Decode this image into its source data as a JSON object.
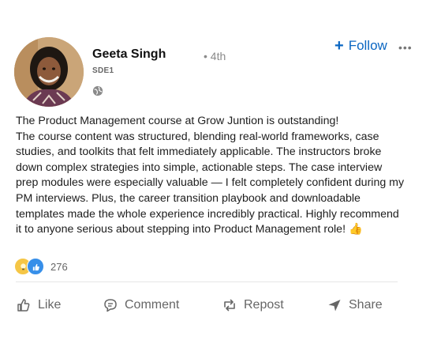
{
  "author": {
    "name": "Geeta Singh",
    "connection_degree": "• 4th",
    "headline": "SDE1",
    "visibility_icon": "globe-icon"
  },
  "header_actions": {
    "follow_label": "Follow",
    "follow_icon": "+",
    "more_icon": "•••"
  },
  "post": {
    "lines": [
      "The Product Management course at Grow Juntion is outstanding!",
      "The course content was structured, blending real-world frameworks, case studies, and toolkits that felt immediately applicable. The instructors broke down complex strategies into simple, actionable steps. The case interview prep modules were especially valuable — I felt completely confident during my PM interviews. Plus, the career transition playbook and downloadable templates made the whole experience incredibly practical. Highly recommend it to anyone serious about stepping into Product Management role! 👍"
    ]
  },
  "reactions": {
    "icons": [
      "insightful-icon",
      "like-icon"
    ],
    "count": "276"
  },
  "actions": {
    "like": "Like",
    "comment": "Comment",
    "repost": "Repost",
    "share": "Share"
  },
  "colors": {
    "accent": "#0a66c2",
    "like_reaction": "#378fe9",
    "insightful_reaction": "#f5c646"
  }
}
